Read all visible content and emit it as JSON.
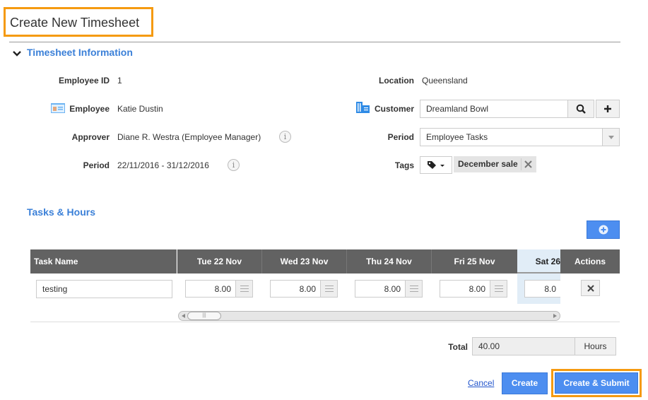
{
  "page": {
    "title": "Create New Timesheet"
  },
  "info_section": {
    "title": "Timesheet Information",
    "employee_id": {
      "label": "Employee ID",
      "value": "1"
    },
    "employee": {
      "label": "Employee",
      "value": "Katie Dustin"
    },
    "approver": {
      "label": "Approver",
      "value": "Diane R. Westra (Employee Manager)"
    },
    "period": {
      "label": "Period",
      "value": "22/11/2016 - 31/12/2016"
    },
    "location": {
      "label": "Location",
      "value": "Queensland"
    },
    "customer": {
      "label": "Customer",
      "value": "Dreamland Bowl"
    },
    "period_select": {
      "label": "Period",
      "value": "Employee Tasks"
    },
    "tags": {
      "label": "Tags",
      "items": [
        "December sale"
      ]
    }
  },
  "tasks_section": {
    "title": "Tasks & Hours",
    "columns": [
      "Task Name",
      "Tue 22 Nov",
      "Wed 23 Nov",
      "Thu 24 Nov",
      "Fri 25 Nov",
      "Sat 26",
      "Actions"
    ],
    "rows": [
      {
        "task": "testing",
        "hours": [
          "8.00",
          "8.00",
          "8.00",
          "8.00",
          "8.0"
        ]
      }
    ]
  },
  "totals": {
    "label": "Total",
    "value": "40.00",
    "unit": "Hours"
  },
  "actions": {
    "cancel": "Cancel",
    "create": "Create",
    "create_submit": "Create & Submit"
  }
}
